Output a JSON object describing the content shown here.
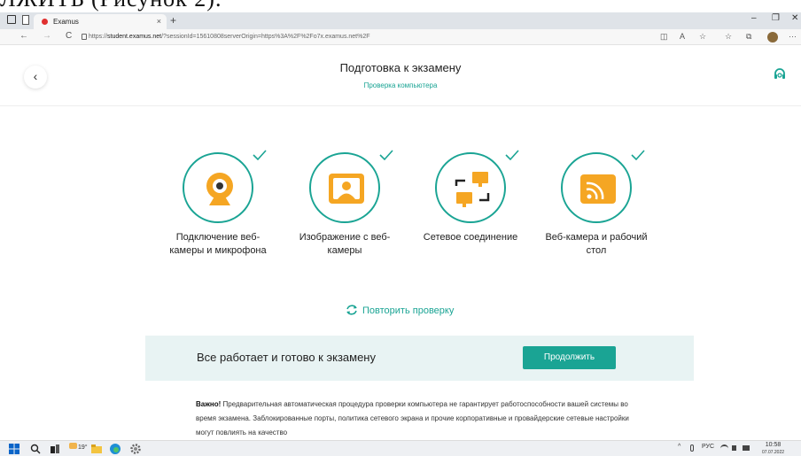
{
  "document_fragment": "ЛЖИТЬ (Рисунок 2).",
  "browser": {
    "tab_title": "Examus",
    "tab_close": "×",
    "new_tab": "+",
    "window_controls": [
      "–",
      "❐",
      "✕"
    ],
    "url_prefix": "https://",
    "url_host": "student.examus.net",
    "url_rest": "/?sessionId=15610808serverOrigin=https%3A%2F%2Fo7x.examus.net%2F",
    "nav": [
      "←",
      "→",
      "C"
    ],
    "toolbar_icons": [
      "◫",
      "A",
      "☆",
      "☆",
      "⧉",
      "avatar",
      "···"
    ]
  },
  "page": {
    "back": "‹",
    "title": "Подготовка к экзамену",
    "subtitle": "Проверка компьютера",
    "accent": "#1aa494",
    "icon_orange": "#f5a623",
    "steps": [
      {
        "label": "Подключение веб-камеры и микрофона",
        "icon": "webcam-icon",
        "status": "ok"
      },
      {
        "label": "Изображение с веб-камеры",
        "icon": "camera-image-icon",
        "status": "ok"
      },
      {
        "label": "Сетевое соединение",
        "icon": "network-icon",
        "status": "ok"
      },
      {
        "label": "Веб-камера и рабочий стол",
        "icon": "screen-cast-icon",
        "status": "ok"
      }
    ],
    "retry": "Повторить проверку",
    "ready_message": "Все работает и готово к экзамену",
    "continue_button": "Продолжить",
    "note_bold": "Важно!",
    "note_text": " Предварительная автоматическая процедура проверки компьютера не гарантирует работоспособности вашей системы во время экзамена. Заблокированные порты, политика сетевого экрана и прочие корпоративные и провайдерские сетевые настройки могут повлиять на качество"
  },
  "taskbar": {
    "weather": "19°",
    "lang": "РУС",
    "time": "10:58",
    "date": "07.07.2022"
  }
}
